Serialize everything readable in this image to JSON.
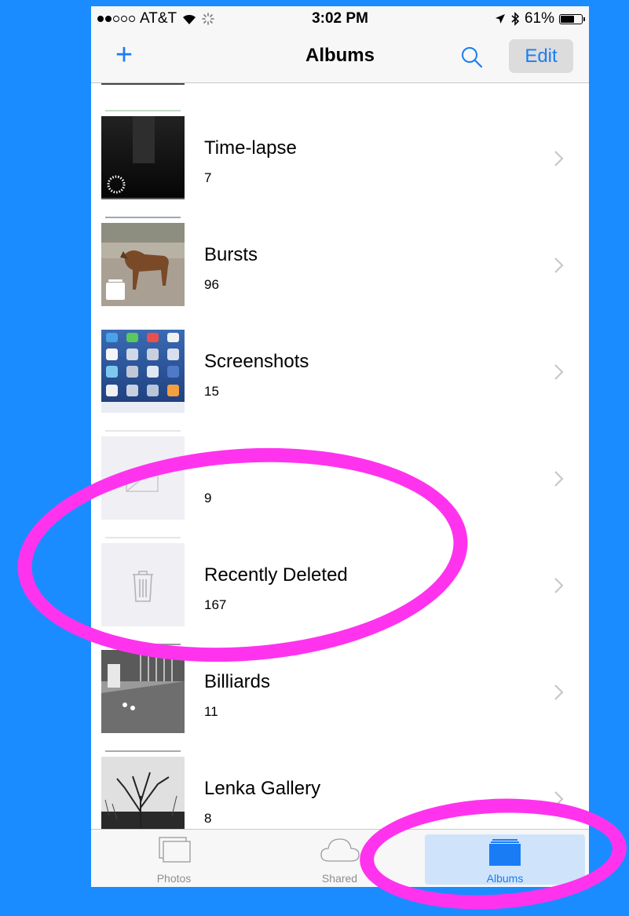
{
  "status": {
    "carrier": "AT&T",
    "time": "3:02 PM",
    "battery": "61%",
    "battery_level": 0.61,
    "signal_bars": 2
  },
  "navbar": {
    "title": "Albums",
    "add_icon": "plus-icon",
    "search_icon": "search-icon",
    "edit_label": "Edit"
  },
  "albums": [
    {
      "name": "Time-lapse",
      "count": "7"
    },
    {
      "name": "Bursts",
      "count": "96"
    },
    {
      "name": "Screenshots",
      "count": "15"
    },
    {
      "name": "",
      "count": "9"
    },
    {
      "name": "Recently Deleted",
      "count": "167"
    },
    {
      "name": "Billiards",
      "count": "11"
    },
    {
      "name": "Lenka Gallery",
      "count": "8"
    }
  ],
  "tabs": [
    {
      "label": "Photos",
      "icon": "photos-icon"
    },
    {
      "label": "Shared",
      "icon": "cloud-icon"
    },
    {
      "label": "Albums",
      "icon": "albums-icon"
    }
  ],
  "colors": {
    "accent": "#1a7cf5",
    "background": "#1a8cff",
    "highlight_circle": "#ff33ee"
  }
}
